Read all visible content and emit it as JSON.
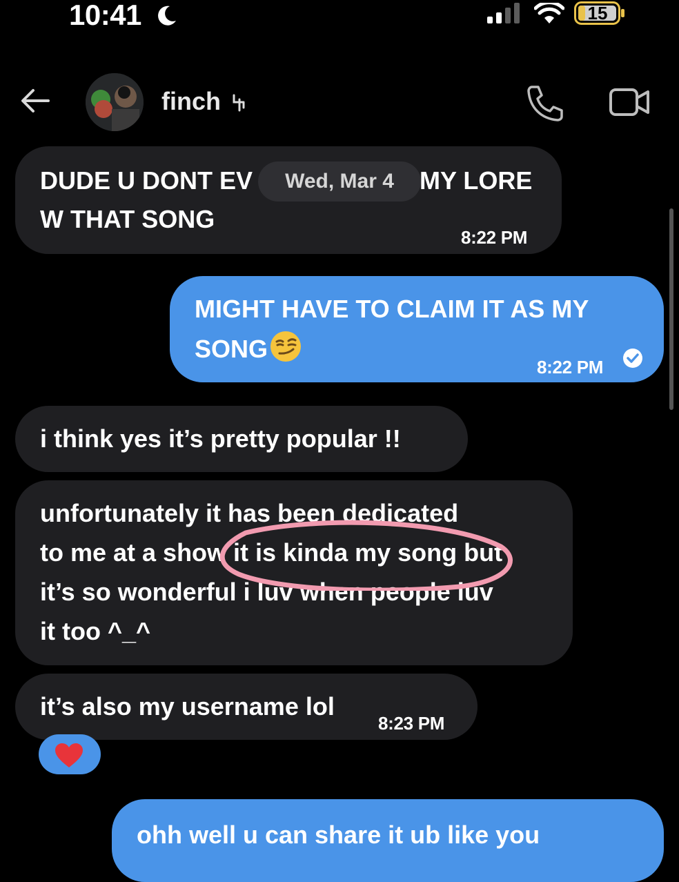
{
  "status_bar": {
    "time": "10:41",
    "battery": "15",
    "icons": [
      "moon-icon",
      "signal-icon",
      "wifi-icon",
      "battery-icon"
    ]
  },
  "header": {
    "contact_name": "finch",
    "icons": [
      "back-arrow-icon",
      "contact-avatar",
      "phone-icon",
      "video-call-icon"
    ]
  },
  "date_separator": "Wed, Mar 4",
  "messages": [
    {
      "direction": "incoming",
      "lines": [
        "DUDE U DONT EV",
        "MY LORE",
        "W THAT SONG"
      ],
      "time": "8:22 PM"
    },
    {
      "direction": "outgoing",
      "lines": [
        "MIGHT HAVE TO CLAIM IT AS MY",
        "SONG"
      ],
      "emoji": "smirking-face",
      "time": "8:22 PM",
      "status": "read"
    },
    {
      "direction": "incoming",
      "lines": [
        "i think yes it’s pretty popular !!"
      ]
    },
    {
      "direction": "incoming",
      "lines": [
        "unfortunately it has been dedicated",
        "to me at a show it is kinda my song but",
        "it’s so wonderful i luv when people luv",
        "it too ^_^"
      ]
    },
    {
      "direction": "incoming",
      "lines": [
        "it’s also my username lol"
      ],
      "time": "8:23 PM",
      "reaction": "red-heart"
    },
    {
      "direction": "outgoing",
      "lines": [
        "ohh well u can share it ub like you"
      ]
    }
  ],
  "colors": {
    "background": "#000000",
    "incoming_bubble": "#1f1f22",
    "outgoing_bubble": "#4a94e8",
    "annotation_circle": "#f29bb0"
  }
}
